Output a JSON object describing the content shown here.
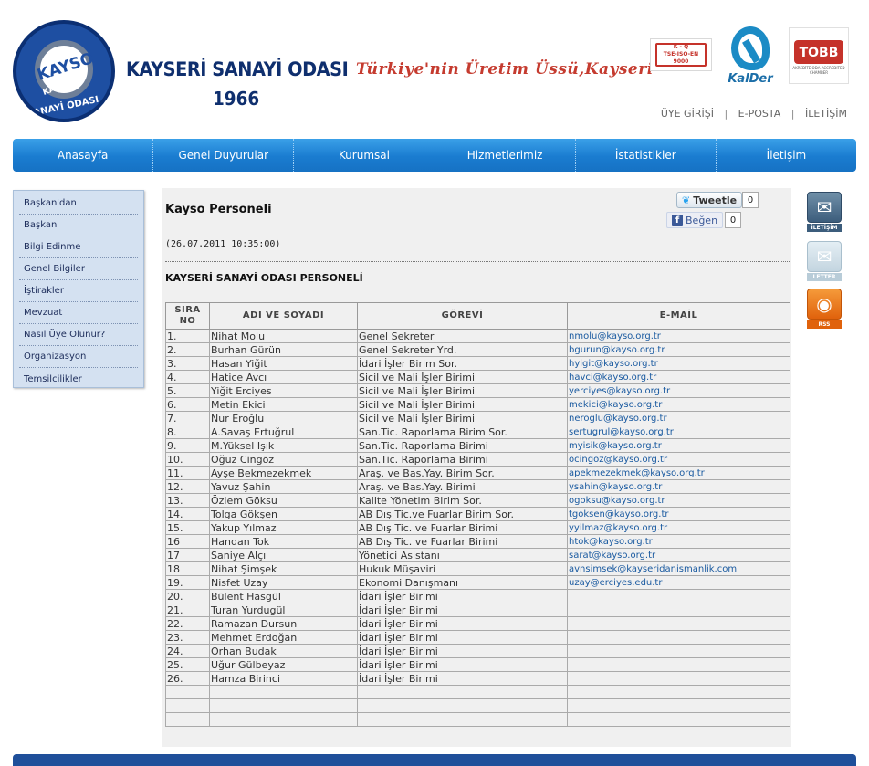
{
  "header": {
    "logo_text": "KAYSO",
    "logo_ring_top": "KAYSERİ",
    "logo_ring_bottom": "SANAYİ ODASI",
    "org_name": "KAYSERİ SANAYİ ODASI",
    "org_year": "1966",
    "slogan": "Türkiye'nin Üretim Üssü,Kayseri",
    "tse_badge": {
      "line1": "K - Q",
      "line2": "TSE-ISO-EN",
      "line3": "9000"
    },
    "kalder_label": "KalDer",
    "tobb_label": "TOBB",
    "tobb_sub": "AKREDİTE ODA ACCREDITED CHAMBER",
    "top_links": [
      {
        "label": "ÜYE GİRİŞİ"
      },
      {
        "label": "E-POSTA"
      },
      {
        "label": "İLETİŞİM"
      }
    ],
    "top_link_separator": "|"
  },
  "nav": {
    "items": [
      {
        "label": "Anasayfa"
      },
      {
        "label": "Genel Duyurular"
      },
      {
        "label": "Kurumsal"
      },
      {
        "label": "Hizmetlerimiz"
      },
      {
        "label": "İstatistikler"
      },
      {
        "label": "İletişim"
      }
    ]
  },
  "sidebar": {
    "items": [
      {
        "label": "Başkan'dan"
      },
      {
        "label": "Başkan"
      },
      {
        "label": "Bilgi Edinme"
      },
      {
        "label": "Genel Bilgiler"
      },
      {
        "label": "İştirakler"
      },
      {
        "label": "Mevzuat"
      },
      {
        "label": "Nasıl Üye Olunur?"
      },
      {
        "label": "Organizasyon"
      },
      {
        "label": "Temsilcilikler"
      }
    ]
  },
  "content": {
    "title": "Kayso Personeli",
    "date": "(26.07.2011 10:35:00)",
    "heading": "KAYSERİ SANAYİ ODASI PERSONELİ",
    "social": {
      "tweet_label": "Tweetle",
      "tweet_count": "0",
      "like_label": "Beğen",
      "like_count": "0"
    },
    "table": {
      "headers": {
        "no_line1": "SIRA",
        "no_line2": "NO",
        "name": "ADI VE SOYADI",
        "role": "GÖREVİ",
        "email": "E-MAİL"
      },
      "rows": [
        [
          "1.",
          "Nihat Molu",
          "Genel Sekreter",
          "nmolu@kayso.org.tr"
        ],
        [
          "2.",
          "Burhan Gürün",
          "Genel Sekreter Yrd.",
          "bgurun@kayso.org.tr"
        ],
        [
          "3.",
          "Hasan Yiğit",
          "İdari İşler Birim Sor.",
          "hyigit@kayso.org.tr"
        ],
        [
          "4.",
          "Hatice Avcı",
          "Sicil ve Mali İşler Birimi",
          "havci@kayso.org.tr"
        ],
        [
          "5.",
          "Yiğit Erciyes",
          "Sicil ve Mali İşler Birimi",
          "yerciyes@kayso.org.tr"
        ],
        [
          "6.",
          "Metin Ekici",
          "Sicil ve Mali İşler Birimi",
          "mekici@kayso.org.tr"
        ],
        [
          "7.",
          "Nur Eroğlu",
          "Sicil ve Mali İşler Birimi",
          "neroglu@kayso.org.tr"
        ],
        [
          "8.",
          "A.Savaş Ertuğrul",
          "San.Tic. Raporlama Birim Sor.",
          "sertugrul@kayso.org.tr"
        ],
        [
          "9.",
          "M.Yüksel Işık",
          "San.Tic. Raporlama Birimi",
          "myisik@kayso.org.tr"
        ],
        [
          "10.",
          "Oğuz Cingöz",
          "San.Tic. Raporlama Birimi",
          "ocingoz@kayso.org.tr"
        ],
        [
          "11.",
          "Ayşe Bekmezekmek",
          "Araş. ve Bas.Yay. Birim Sor.",
          "apekmezekmek@kayso.org.tr"
        ],
        [
          "12.",
          "Yavuz Şahin",
          "Araş. ve Bas.Yay. Birimi",
          "ysahin@kayso.org.tr"
        ],
        [
          "13.",
          "Özlem Göksu",
          "Kalite Yönetim Birim Sor.",
          "ogoksu@kayso.org.tr"
        ],
        [
          "14.",
          "Tolga Gökşen",
          "AB Dış Tic.ve Fuarlar Birim Sor.",
          "tgoksen@kayso.org.tr"
        ],
        [
          "15.",
          "Yakup Yılmaz",
          "AB Dış Tic. ve Fuarlar Birimi",
          "yyilmaz@kayso.org.tr"
        ],
        [
          "16",
          "Handan Tok",
          "AB Dış Tic. ve Fuarlar Birimi",
          "htok@kayso.org.tr"
        ],
        [
          "17",
          "Saniye Alçı",
          "Yönetici Asistanı",
          "sarat@kayso.org.tr"
        ],
        [
          "18",
          "Nihat Şimşek",
          "Hukuk Müşaviri",
          "avnsimsek@kayseridanismanlik.com"
        ],
        [
          "19.",
          "Nisfet Uzay",
          "Ekonomi Danışmanı",
          "uzay@erciyes.edu.tr"
        ],
        [
          "20.",
          "Bülent Hasgül",
          "İdari İşler Birimi",
          ""
        ],
        [
          "21.",
          "Turan Yurdugül",
          "İdari İşler Birimi",
          ""
        ],
        [
          "22.",
          "Ramazan Dursun",
          "İdari İşler Birimi",
          ""
        ],
        [
          "23.",
          "Mehmet Erdoğan",
          "İdari İşler Birimi",
          ""
        ],
        [
          "24.",
          "Orhan Budak",
          "İdari İşler Birimi",
          ""
        ],
        [
          "25.",
          "Uğur Gülbeyaz",
          "İdari İşler Birimi",
          ""
        ],
        [
          "26.",
          "Hamza Birinci",
          "İdari İşler Birimi",
          ""
        ],
        [
          "",
          "",
          "",
          ""
        ],
        [
          "",
          "",
          "",
          ""
        ],
        [
          "",
          "",
          "",
          ""
        ]
      ]
    }
  },
  "right_icons": {
    "contact_label": "İLETİŞİM",
    "letter_label": "LETTER",
    "rss_label": "RSS"
  },
  "colors": {
    "nav_blue": "#1a7cd0",
    "brand_dark": "#0f2f6e",
    "slogan_red": "#c53b2f",
    "link_blue": "#1a5aa0"
  }
}
